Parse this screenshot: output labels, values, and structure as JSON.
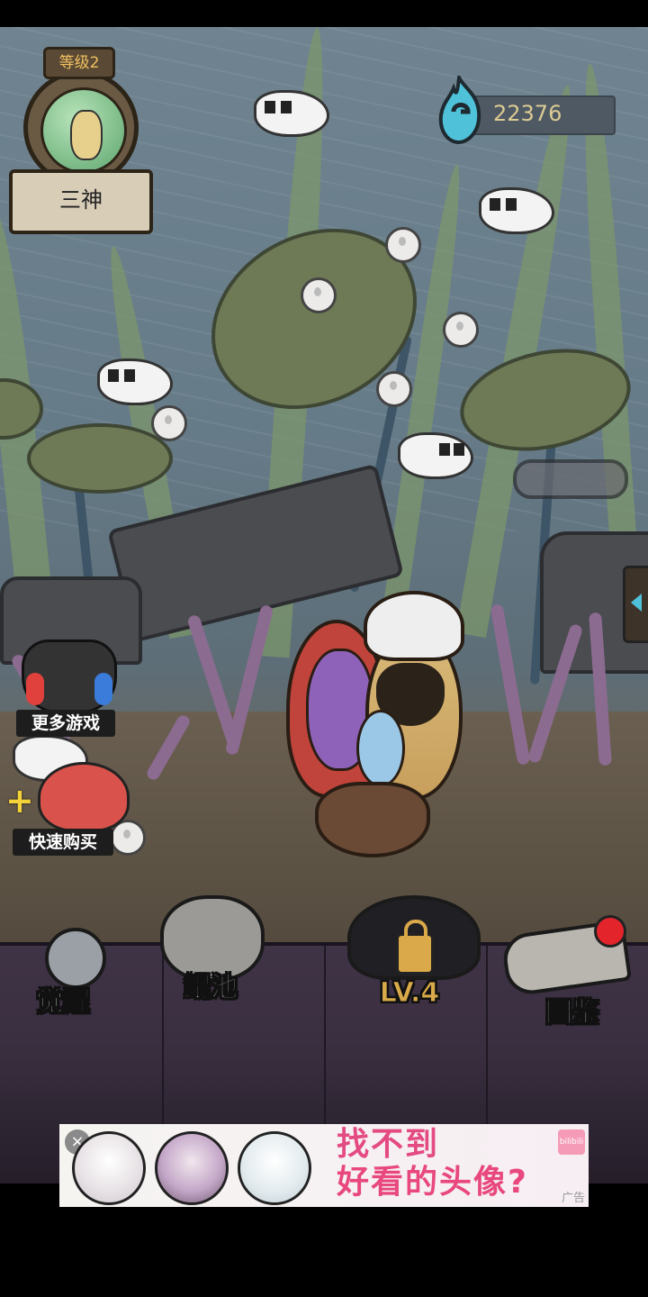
{
  "player": {
    "level_label": "等级2",
    "name": "三神"
  },
  "currency": {
    "icon": "gem-icon",
    "amount": "22376",
    "color": "#4fc1d9"
  },
  "side_buttons": {
    "more_games": "更多游戏",
    "quick_buy": "快速购买"
  },
  "bottom_nav": [
    {
      "id": "awaken",
      "label": "觉醒",
      "icon": "ghost-statue-icon"
    },
    {
      "id": "pool",
      "label": "鲲池",
      "icon": "fish-bowl-icon"
    },
    {
      "id": "locked",
      "label": "LV.4",
      "icon": "lock-icon",
      "locked": true
    },
    {
      "id": "codex",
      "label": "图鉴",
      "icon": "scroll-icon",
      "badge": true
    }
  ],
  "ad": {
    "line1": "找不到",
    "line2": "好看的头像?",
    "tag": "广告",
    "close": "×",
    "logo": "bilibili"
  },
  "colors": {
    "accent_red": "#e3242b",
    "label_gold": "#f0c060",
    "ad_pink": "#e44b83"
  }
}
